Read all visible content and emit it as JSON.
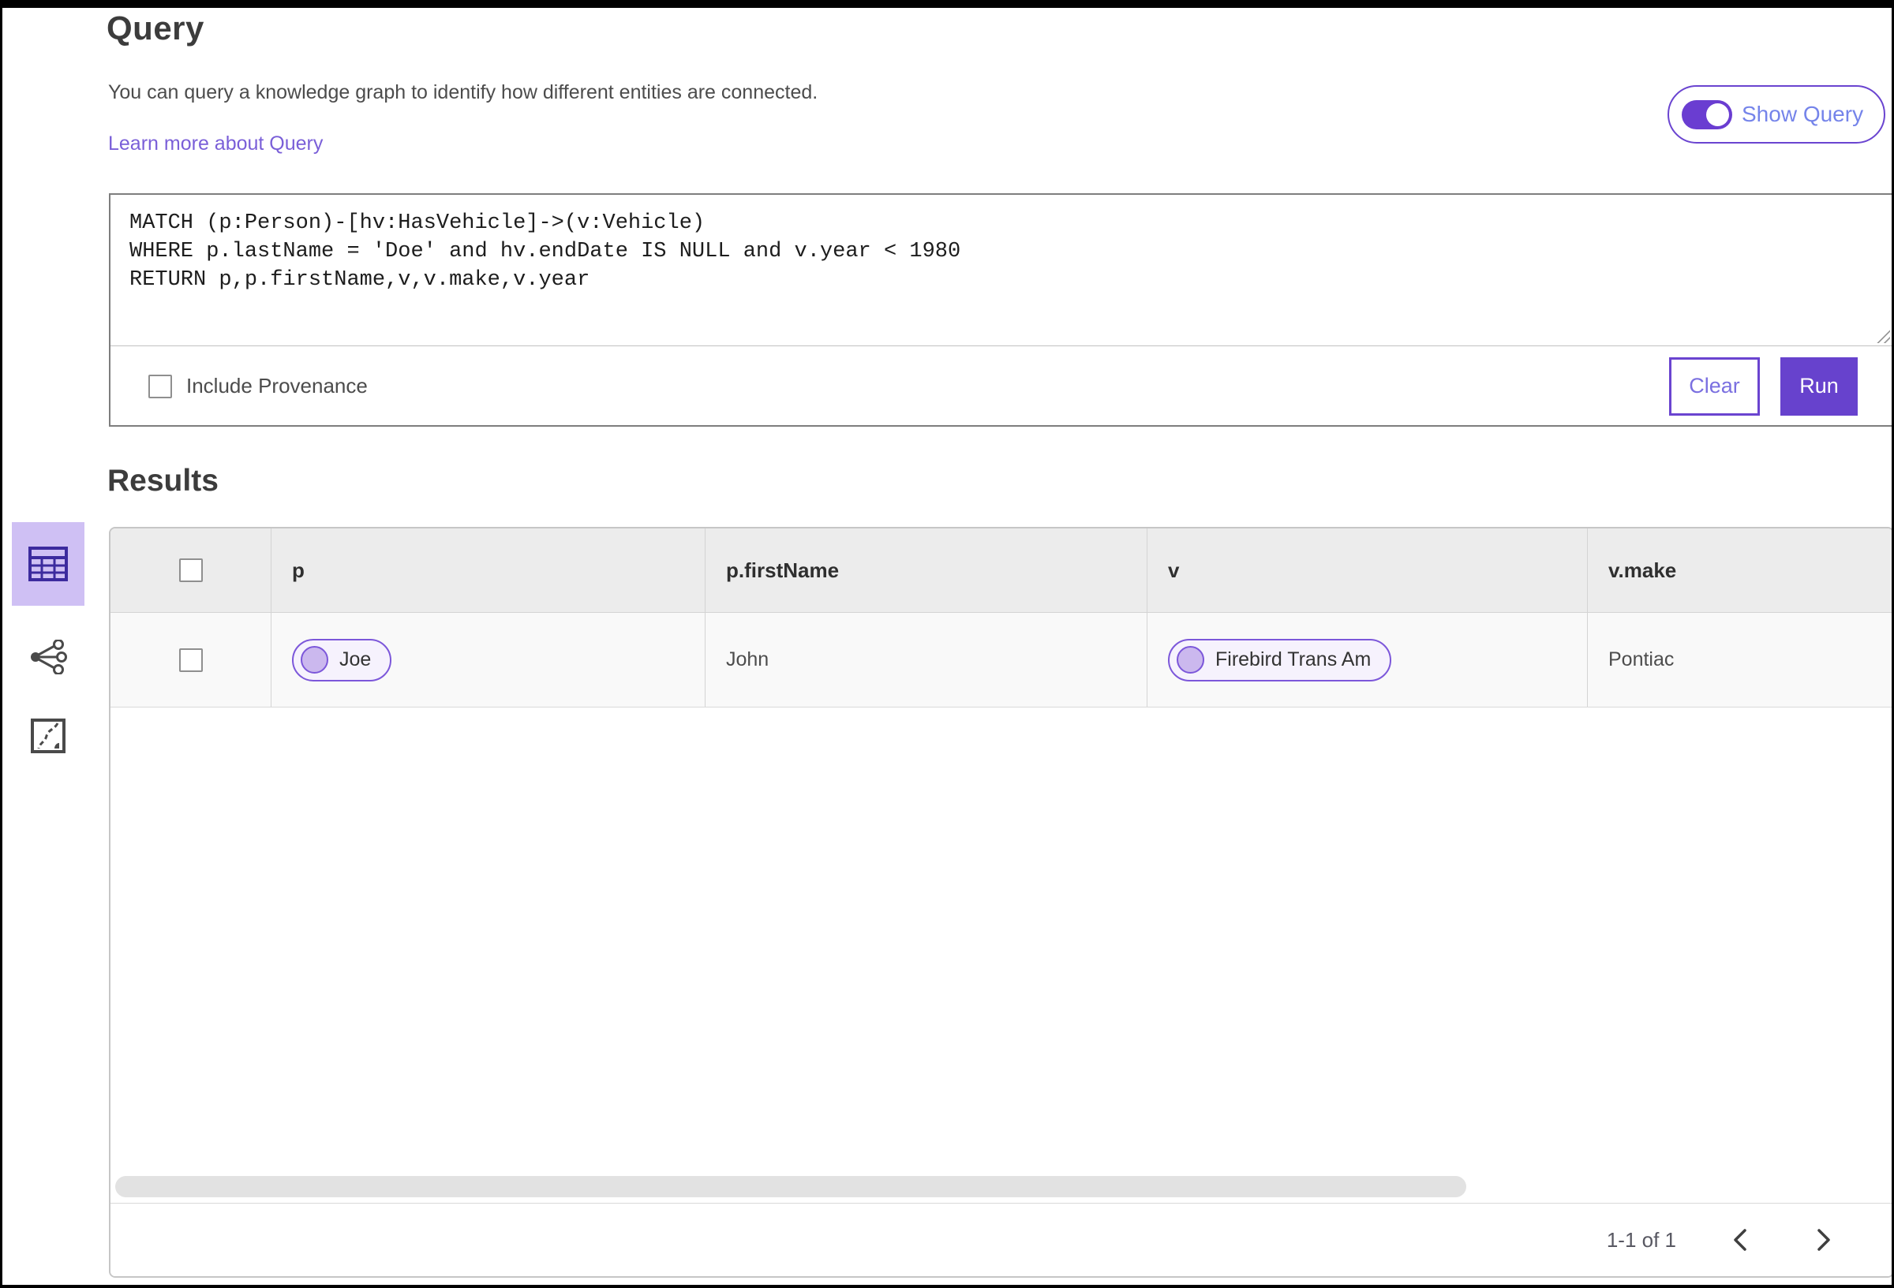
{
  "header": {
    "title": "Query",
    "description": "You can query a knowledge graph to identify how different entities are connected.",
    "learn_more_link": "Learn more about Query",
    "show_query": {
      "label": "Show Query",
      "enabled": true
    }
  },
  "query_editor": {
    "code": "MATCH (p:Person)-[hv:HasVehicle]->(v:Vehicle)\nWHERE p.lastName = 'Doe' and hv.endDate IS NULL and v.year < 1980\nRETURN p,p.firstName,v,v.make,v.year",
    "include_provenance": {
      "label": "Include Provenance",
      "checked": false
    },
    "buttons": {
      "clear": "Clear",
      "run": "Run"
    }
  },
  "results": {
    "heading": "Results",
    "views": [
      {
        "name": "table-view",
        "icon": "table-icon",
        "selected": true
      },
      {
        "name": "link-chart-view",
        "icon": "link-chart-icon",
        "selected": false
      },
      {
        "name": "map-view",
        "icon": "map-icon",
        "selected": false
      }
    ],
    "table": {
      "columns": [
        "p",
        "p.firstName",
        "v",
        "v.make"
      ],
      "rows": [
        {
          "selected": false,
          "p_label": "Joe",
          "p_firstName": "John",
          "v_label": "Firebird Trans Am",
          "v_make": "Pontiac"
        }
      ]
    },
    "pagination": {
      "range_label": "1-1 of 1"
    }
  },
  "colors": {
    "accent_purple": "#6a44d0",
    "run_button": "#6742cd",
    "selected_view_bg": "#cfc0f4",
    "icon_purple": "#3c2b9e",
    "pill_border": "#7c57da",
    "pill_bg": "#f6f2fd",
    "pill_dot": "#cbb8ee",
    "link": "#7a5fd8",
    "header_row_bg": "#ececec",
    "data_row_bg": "#f9f9f9"
  }
}
